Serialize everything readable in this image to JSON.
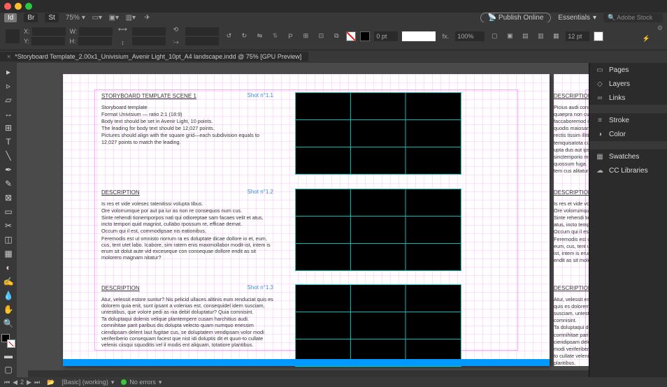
{
  "app": {
    "zoom": "75%",
    "publish": "Publish Online",
    "workspace": "Essentials",
    "search_placeholder": "Adobe Stock",
    "tabs": {
      "id": "Id",
      "br": "Br",
      "st": "St"
    }
  },
  "ctrl": {
    "X": "X:",
    "Y": "Y:",
    "W": "W:",
    "H": "H:",
    "stroke": "0 pt",
    "font": "12 pt",
    "pct": "100%"
  },
  "doc": {
    "title": "*Storyboard Template_2.00x1_Univisium_Avenir Light_10pt_A4 landscape.indd @ 75% [GPU Preview]"
  },
  "entries": [
    {
      "header": "STORYBOARD TEMPLATE SCENE 1",
      "shot": "Shot n°1.1",
      "paras": [
        "Storyboard template",
        "Format Univisium — ratio 2:1 (18:9)",
        "Body text should be set in Avenir Light, 10 points.",
        "The leading for body text should be 12,027 points.",
        "Pictures should align with the square grid—each subdivision equals to 12,027 points to match the leading."
      ]
    },
    {
      "header": "DESCRIPTION",
      "shot": "Shot n°1.2",
      "paras": [
        "Is res et vide volesec tatenitissi volupta tibus.",
        "Ore volorrumque por aut pa iur as non re consequos num cus.",
        "Sinte rehendi tionemporpos nati qui odioreptae sam facaes velit et atus, incto tempori quid magnist, cullabo rpossum re, efficae dernat.",
        "Occum qui il est, commodipsae nis eationibus.",
        "Feremodis est ut omnisto riorrum ra es doluptate dicae dollore io et, eum, cus, tent utet labo. Icabore, sim ratem enis maximollabor modit-ist, intem is erum sit dolut aute vid exceseque con consequae dollore endit as sit molorero magnam nitatur?"
      ]
    },
    {
      "header": "DESCRIPTION",
      "shot": "Shot n°1.3",
      "paras": [
        "Atur, velessit estore suntur? Nis pelicid ullaces alitinis eum renduciat quis es dolorem quia enit, sunt ipsant a volenias est, consequidel idem susciam, untestibus, que volore pedi as nia debit doluptatur? Quia comnisint.",
        "Ta doluptaqui dolenis velique plantempere cusam harchitius audi. comnihitae parit paribus dis dolupta velecto quam numquo enessim ciendipsam delent laut fugitae cus, se doluptatem vendipsam volor modi veriferiberio consequam facest que nist idi doluptis dit et quun-to cullate velenis ciisqui squoditis vel il modis ent aliquam, totatiore plantibus."
      ]
    }
  ],
  "page2entries": [
    {
      "header": "DESCRIPTION",
      "paras": [
        "Picius audi consequ",
        "quaepra non cusa a",
        "faccaboremod ipsu",
        "quodis maiosandit",
        "rectis tissim illitium",
        "temquisatota cus cul",
        "upta dus aut ipsust l",
        "sinctemporio molup",
        "quossum fuga. Nam",
        "tem cus alitatur abo"
      ]
    },
    {
      "header": "DESCRIPTION",
      "paras": [
        "Is res et vide volese",
        "Ore volorrumque po",
        "Sinte rehendi tionem",
        "atus, incto tempori",
        "Occum qui il est, co",
        "Feremodis est ut om",
        "eum, cus, tent utet l",
        "ist, intem is erum sit",
        "endit as sit molorero"
      ]
    },
    {
      "header": "DESCRIPTION",
      "paras": [
        "Atur, velessit estore",
        "quis es dolorem qui",
        "susciam, untestibus",
        "comnisint.",
        "Ta doluptaqui dolen",
        "comnihitae parit par",
        "ciendipsam delent la",
        "modi veriferiberio c",
        "to cullate velenis cii",
        "plantibus."
      ]
    }
  ],
  "panels": [
    {
      "icon": "▭",
      "label": "Pages"
    },
    {
      "icon": "◇",
      "label": "Layers"
    },
    {
      "icon": "∞",
      "label": "Links"
    },
    {
      "sep": true
    },
    {
      "icon": "≡",
      "label": "Stroke"
    },
    {
      "icon": "◑",
      "label": "Color"
    },
    {
      "sep": true
    },
    {
      "icon": "▦",
      "label": "Swatches"
    },
    {
      "icon": "☁",
      "label": "CC Libraries"
    }
  ],
  "status": {
    "page": "2",
    "style": "[Basic] (working)",
    "errors": "No errors"
  }
}
